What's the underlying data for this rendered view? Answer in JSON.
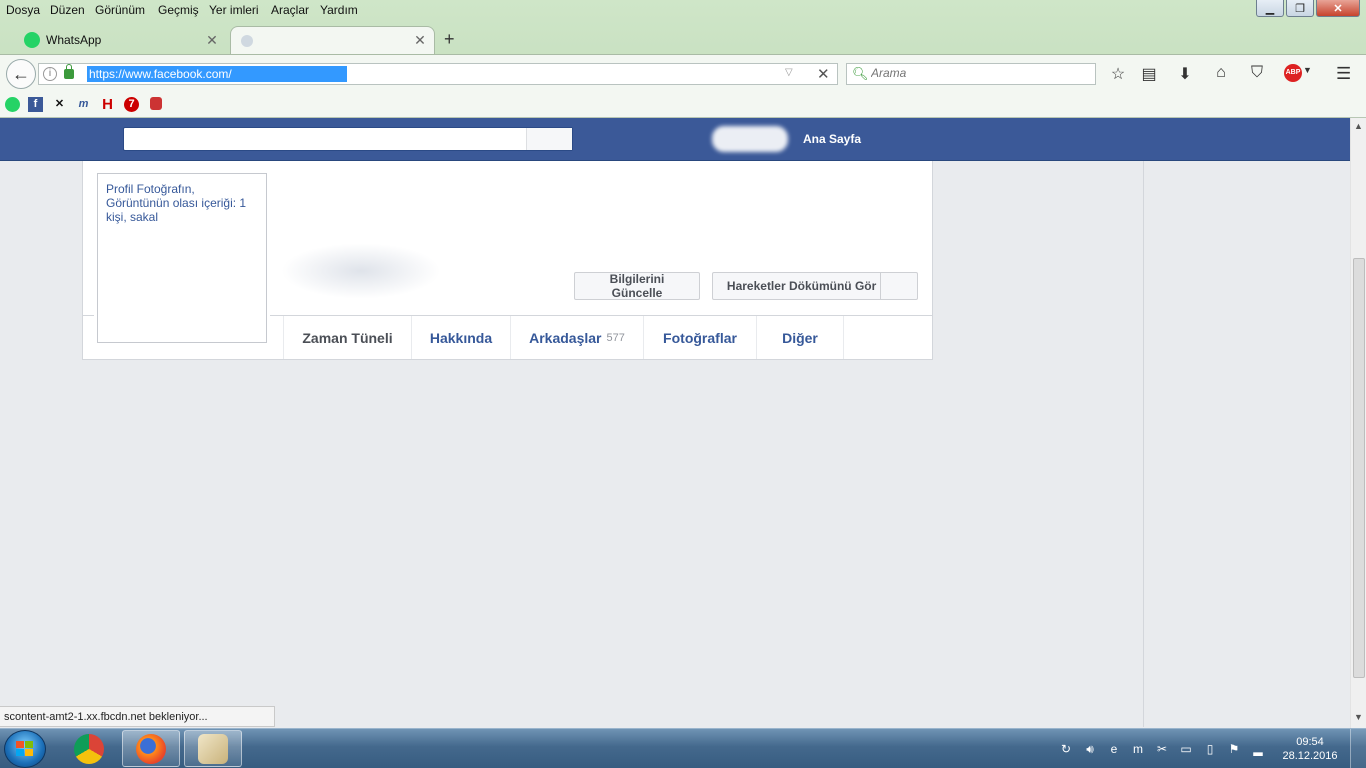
{
  "menu": [
    "Dosya",
    "Düzen",
    "Görünüm",
    "Geçmiş",
    "Yer imleri",
    "Araçlar",
    "Yardım"
  ],
  "tabs": [
    {
      "title": "WhatsApp",
      "active": false
    },
    {
      "title": "",
      "active": true
    }
  ],
  "address_bar": {
    "url": "https://www.facebook.com/"
  },
  "search_bar": {
    "placeholder": "Arama"
  },
  "facebook": {
    "header": {
      "search_value": "",
      "home_link": "Ana Sayfa",
      "color": "#3b5998"
    },
    "profile": {
      "photo_alt": "Profil Fotoğrafın, Görüntünün olası içeriği: 1 kişi, sakal",
      "update_info_button": "Bilgilerini Güncelle",
      "activity_log_button": "Hareketler Dökümünü Gör"
    },
    "profile_tabs": [
      {
        "label": "Zaman Tüneli"
      },
      {
        "label": "Hakkında"
      },
      {
        "label": "Arkadaşlar",
        "count": "577"
      },
      {
        "label": "Fotoğraflar"
      },
      {
        "label": "Diğer"
      }
    ]
  },
  "status_text": "scontent-amt2-1.xx.fbcdn.net bekleniyor...",
  "taskbar": {
    "apps": [
      "chrome-icon",
      "firefox-icon",
      "paint-icon"
    ],
    "clock": {
      "time": "09:54",
      "date": "28.12.2016"
    }
  }
}
